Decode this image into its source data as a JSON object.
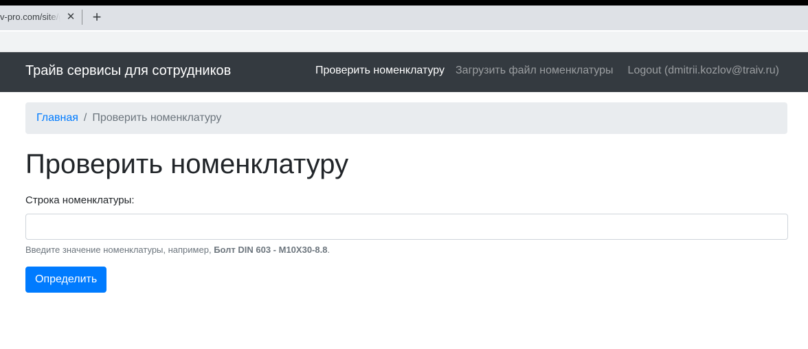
{
  "browser": {
    "tab_title": "v-pro.com/site/ge",
    "close_glyph": "✕",
    "new_tab_glyph": "+"
  },
  "navbar": {
    "brand": "Трайв сервисы для сотрудников",
    "links": [
      {
        "label": "Проверить номенклатуру",
        "active": true
      },
      {
        "label": "Загрузить файл номенклатуры",
        "active": false
      },
      {
        "label": "Logout (dmitrii.kozlov@traiv.ru)",
        "active": false
      }
    ]
  },
  "breadcrumb": {
    "home": "Главная",
    "separator": "/",
    "current": "Проверить номенклатуру"
  },
  "page": {
    "title": "Проверить номенклатуру"
  },
  "form": {
    "label": "Строка номенклатуры:",
    "input_value": "",
    "help_prefix": "Введите значение номенклатуры, например, ",
    "help_example": "Болт DIN 603 - M10X30-8.8",
    "help_suffix": ".",
    "submit_label": "Определить"
  },
  "colors": {
    "navbar_bg": "#343a40",
    "primary": "#007bff",
    "breadcrumb_bg": "#e9ecef",
    "muted": "#6c757d"
  },
  "icons": {
    "tab_close": "close-icon",
    "new_tab": "plus-icon"
  }
}
